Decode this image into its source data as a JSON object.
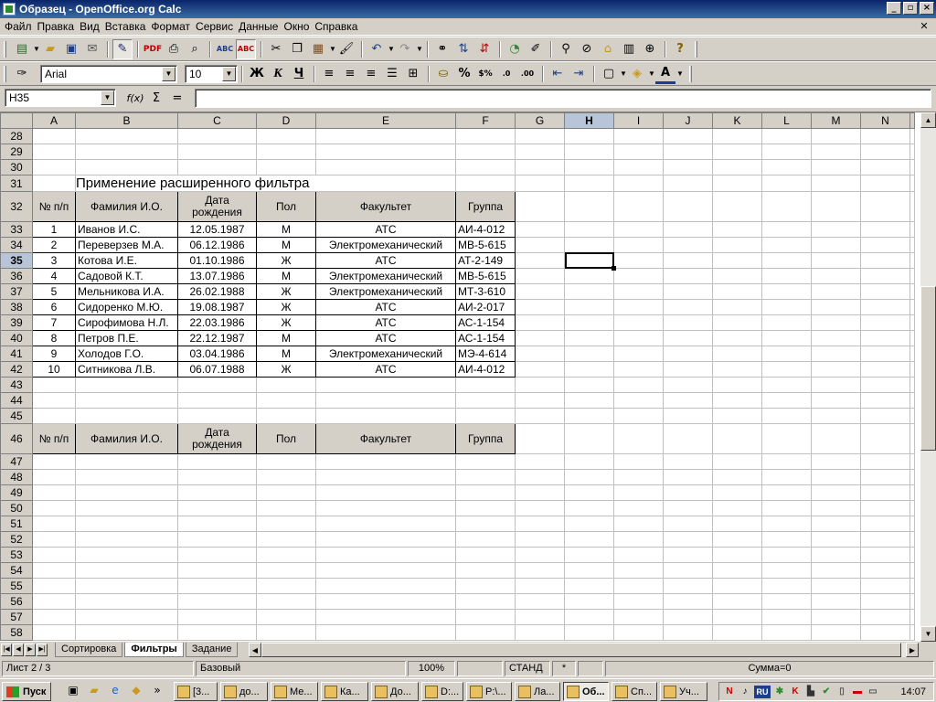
{
  "window": {
    "title": "Образец - OpenOffice.org Calc",
    "min": "_",
    "max": "▫",
    "close": "×"
  },
  "menu": [
    "Файл",
    "Правка",
    "Вид",
    "Вставка",
    "Формат",
    "Сервис",
    "Данные",
    "Окно",
    "Справка"
  ],
  "format_toolbar": {
    "font_name": "Arial",
    "font_size": "10",
    "bold": "Ж",
    "italic": "К",
    "underline": "Ч"
  },
  "formula_bar": {
    "cell_ref": "H35",
    "fx": "f(x)",
    "sum": "Σ",
    "equals": "=",
    "value": ""
  },
  "grid": {
    "columns": [
      "A",
      "B",
      "C",
      "D",
      "E",
      "F",
      "G",
      "H",
      "I",
      "J",
      "K",
      "L",
      "M",
      "N"
    ],
    "selected_column": "H",
    "selected_row": "35",
    "title_row": "31",
    "title": "Применение расширенного фильтра",
    "header_rows": [
      "32",
      "46"
    ],
    "headers": [
      "№ п/п",
      "Фамилия И.О.",
      "Дата рождения",
      "Пол",
      "Факультет",
      "Группа"
    ],
    "empty_rows_top": [
      "28",
      "29",
      "30"
    ],
    "empty_rows_mid": [
      "43",
      "44",
      "45"
    ],
    "empty_rows_bottom": [
      "47",
      "48",
      "49",
      "50",
      "51",
      "52",
      "53",
      "54",
      "55",
      "56",
      "57",
      "58"
    ],
    "data_rows": [
      {
        "row": "33",
        "n": "1",
        "name": "Иванов И.С.",
        "date": "12.05.1987",
        "sex": "М",
        "faculty": "АТС",
        "group": "АИ-4-012"
      },
      {
        "row": "34",
        "n": "2",
        "name": "Переверзев М.А.",
        "date": "06.12.1986",
        "sex": "М",
        "faculty": "Электромеханический",
        "group": "МВ-5-615"
      },
      {
        "row": "35",
        "n": "3",
        "name": "Котова И.Е.",
        "date": "01.10.1986",
        "sex": "Ж",
        "faculty": "АТС",
        "group": "АТ-2-149"
      },
      {
        "row": "36",
        "n": "4",
        "name": "Садовой К.Т.",
        "date": "13.07.1986",
        "sex": "М",
        "faculty": "Электромеханический",
        "group": "МВ-5-615"
      },
      {
        "row": "37",
        "n": "5",
        "name": "Мельникова И.А.",
        "date": "26.02.1988",
        "sex": "Ж",
        "faculty": "Электромеханический",
        "group": "МТ-3-610"
      },
      {
        "row": "38",
        "n": "6",
        "name": "Сидоренко М.Ю.",
        "date": "19.08.1987",
        "sex": "Ж",
        "faculty": "АТС",
        "group": "АИ-2-017"
      },
      {
        "row": "39",
        "n": "7",
        "name": "Сирофимова Н.Л.",
        "date": "22.03.1986",
        "sex": "Ж",
        "faculty": "АТС",
        "group": "АС-1-154"
      },
      {
        "row": "40",
        "n": "8",
        "name": "Петров П.Е.",
        "date": "22.12.1987",
        "sex": "М",
        "faculty": "АТС",
        "group": "АС-1-154"
      },
      {
        "row": "41",
        "n": "9",
        "name": "Холодов Г.О.",
        "date": "03.04.1986",
        "sex": "М",
        "faculty": "Электромеханический",
        "group": "МЭ-4-614"
      },
      {
        "row": "42",
        "n": "10",
        "name": "Ситникова Л.В.",
        "date": "06.07.1988",
        "sex": "Ж",
        "faculty": "АТС",
        "group": "АИ-4-012"
      }
    ]
  },
  "sheet_tabs": [
    "Сортировка",
    "Фильтры",
    "Задание"
  ],
  "active_tab": "Фильтры",
  "status": {
    "sheet": "Лист 2 / 3",
    "style": "Базовый",
    "zoom": "100%",
    "mode": "СТАНД",
    "modified": "*",
    "sum": "Сумма=0"
  },
  "taskbar": {
    "start": "Пуск",
    "quicklaunch_more": "»",
    "tasks": [
      "[3...",
      "до...",
      "Ме...",
      "Ка...",
      "До...",
      "D:...",
      "P:\\...",
      "Ла...",
      "Об...",
      "Сп...",
      "Уч..."
    ],
    "active_task": "Об...",
    "lang": "RU",
    "clock": "14:07"
  },
  "colors": {
    "title_gradient_start": "#0a246a",
    "title_gradient_end": "#3a6ea5",
    "chrome": "#d4d0c8",
    "header_selected": "#b8c4d8"
  }
}
